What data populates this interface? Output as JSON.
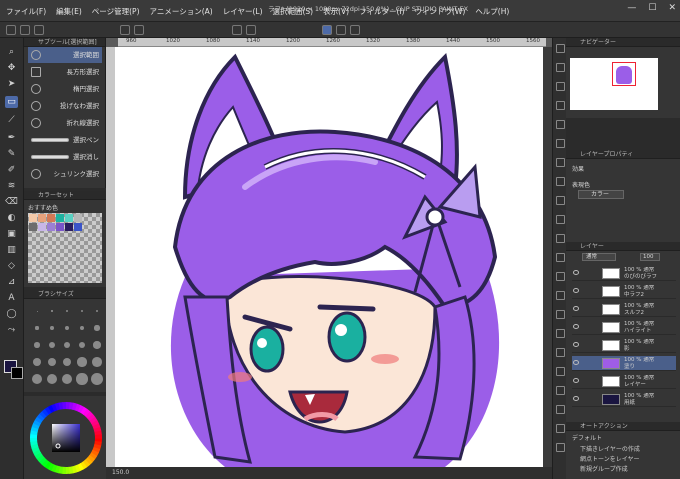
{
  "window": {
    "title": "ラフ* (1920 × 1080px 72dpi 150.0%) - CLIP STUDIO PAINT EX",
    "controls": [
      "—",
      "☐",
      "✕"
    ]
  },
  "menu": [
    "ファイル(F)",
    "編集(E)",
    "ページ管理(P)",
    "アニメーション(A)",
    "レイヤー(L)",
    "選択範囲(S)",
    "表示(V)",
    "フィルター(I)",
    "ウィンドウ(W)",
    "ヘルプ(H)"
  ],
  "subtool_panel": {
    "header": "サブツール[選択範囲]",
    "items": [
      {
        "label": "選択範囲",
        "selected": true
      },
      {
        "label": "長方形選択",
        "selected": false
      },
      {
        "label": "楕円選択",
        "selected": false
      },
      {
        "label": "投げなわ選択",
        "selected": false
      },
      {
        "label": "折れ線選択",
        "selected": false
      },
      {
        "label": "選択ペン",
        "selected": false
      },
      {
        "label": "選択消し",
        "selected": false
      },
      {
        "label": "シュリンク選択",
        "selected": false
      }
    ]
  },
  "palette_panel": {
    "header": "カラーセット",
    "set_name": "おすすめ色",
    "swatches": [
      "#f4c9a8",
      "#e8a27c",
      "#d47a56",
      "#1db3a0",
      "#5ad1c2",
      "#b7b7b7",
      "#6d6d6d",
      "#c8b6e8",
      "#9b7fd4",
      "#7a55c8",
      "#2a1c5e",
      "#3b54c8"
    ]
  },
  "brush_panel": {
    "header": "ブラシサイズ"
  },
  "canvas": {
    "ruler_labels": [
      "960",
      "1020",
      "1080",
      "1140",
      "1200",
      "1260",
      "1320",
      "1380",
      "1440",
      "1500",
      "1560"
    ],
    "status": "150.0"
  },
  "navigator": {
    "header": "ナビゲーター"
  },
  "layer_property": {
    "header": "レイヤープロパティ",
    "effect_label": "効果",
    "expression_label": "表現色",
    "expression_value": "カラー"
  },
  "layers": {
    "header": "レイヤー",
    "blend_mode": "通常",
    "opacity": "100",
    "rows": [
      {
        "name": "100 % 通常\nのびのびラフ",
        "selected": false,
        "thumb": "#ffffff"
      },
      {
        "name": "100 % 通常\n中ラフ2",
        "selected": false,
        "thumb": "#ffffff"
      },
      {
        "name": "100 % 通常\nスルフ2",
        "selected": false,
        "thumb": "#ffffff"
      },
      {
        "name": "100 % 通常\nハイライト",
        "selected": false,
        "thumb": "#ffffff"
      },
      {
        "name": "100 % 通常\n影",
        "selected": false,
        "thumb": "#ffffff"
      },
      {
        "name": "100 % 通常\n塗り",
        "selected": true,
        "thumb": "#9f5de6"
      },
      {
        "name": "100 % 通常\nレイヤー",
        "selected": false,
        "thumb": "#ffffff"
      },
      {
        "name": "100 % 通常\n用紙",
        "selected": false,
        "thumb": "#1a1540"
      }
    ]
  },
  "auto_action": {
    "header": "オートアクション",
    "set": "デフォルト",
    "items": [
      "下描きレイヤーの作成",
      "網点トーンをレイヤー",
      "新規グループ作成"
    ]
  },
  "colors": {
    "main_color": "#1a1540",
    "sub_color": "#000000",
    "hair": "#9b5ee8",
    "hair_light": "#c9a4f7",
    "outline": "#2c2450",
    "eyes": "#1ab0a0",
    "skin": "#fbe6d7",
    "blush": "#f07b7b"
  }
}
